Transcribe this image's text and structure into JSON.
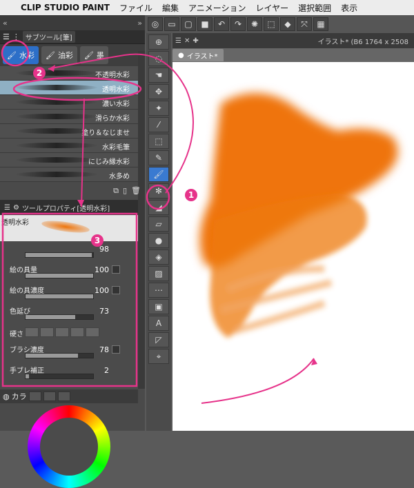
{
  "menubar": {
    "app": "CLIP STUDIO PAINT",
    "items": [
      "ファイル",
      "編集",
      "アニメーション",
      "レイヤー",
      "選択範囲",
      "表示"
    ]
  },
  "subtool": {
    "header": "サブツール[筆]",
    "tabs": [
      {
        "label": "水彩",
        "active": true
      },
      {
        "label": "油彩",
        "active": false
      },
      {
        "label": "墨",
        "active": false
      }
    ],
    "brushes": [
      "不透明水彩",
      "透明水彩",
      "濃い水彩",
      "滑らか水彩",
      "塗り＆なじませ",
      "水彩毛筆",
      "にじみ縁水彩",
      "水多め"
    ],
    "selected": "透明水彩"
  },
  "toolprop": {
    "header": "ツールプロパティ[透明水彩]",
    "preview_label": "透明水彩",
    "props": [
      {
        "name": "",
        "value": "98",
        "fill": 0.98
      },
      {
        "name": "絵の具量",
        "value": "100",
        "fill": 1.0
      },
      {
        "name": "絵の具濃度",
        "value": "100",
        "fill": 1.0
      },
      {
        "name": "色延び",
        "value": "73",
        "fill": 0.73
      },
      {
        "name": "ブラシ濃度",
        "value": "78",
        "fill": 0.78
      },
      {
        "name": "手ブレ補正",
        "value": "2",
        "fill": 0.05
      }
    ],
    "hardness": "硬さ"
  },
  "color_tab": "カラ",
  "document": {
    "tab": "イラスト*",
    "title": "イラスト* (B6 1764 x 2508"
  },
  "annotations": {
    "b1": "1",
    "b2": "2",
    "b3": "3"
  },
  "colors": {
    "accent": "#e6338a",
    "paint": "#ee6e00",
    "selection": "#2d6fc8"
  }
}
